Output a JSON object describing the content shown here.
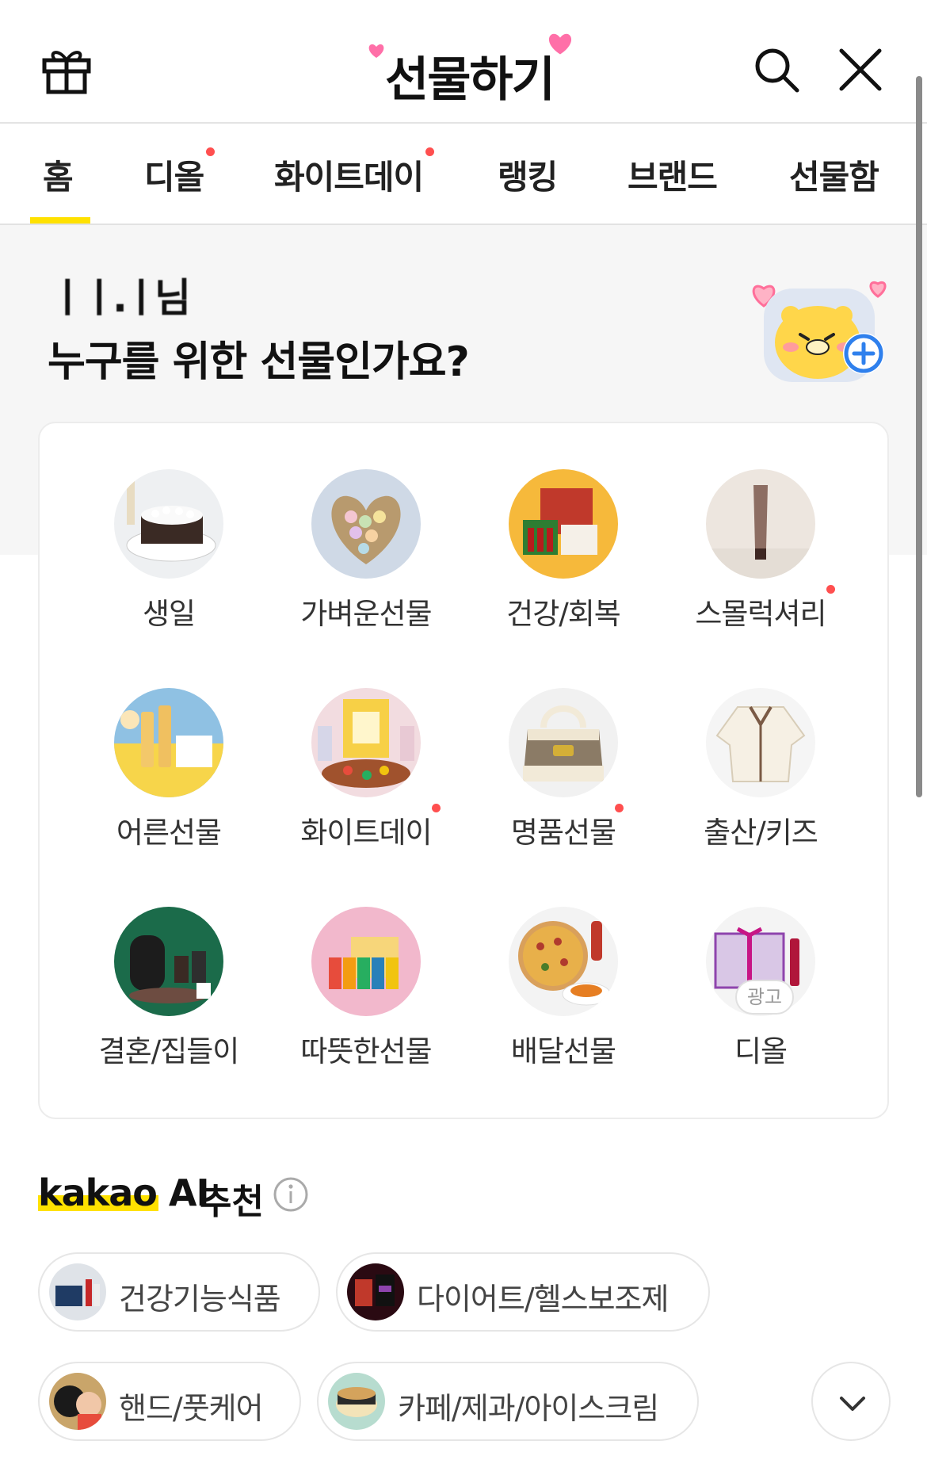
{
  "header": {
    "title": "선물하기",
    "gift_icon": "gift-icon",
    "search_icon": "search-icon",
    "close_icon": "close-icon",
    "accent_color": "#ff6fa8"
  },
  "tabs": [
    {
      "label": "홈",
      "active": true,
      "dot": false
    },
    {
      "label": "디올",
      "active": false,
      "dot": true
    },
    {
      "label": "화이트데이",
      "active": false,
      "dot": true
    },
    {
      "label": "랭킹",
      "active": false,
      "dot": false
    },
    {
      "label": "브랜드",
      "active": false,
      "dot": false
    },
    {
      "label": "선물함",
      "active": false,
      "dot": false
    }
  ],
  "hero": {
    "name": "ㅣㅣ.ㅣ님",
    "question": "누구를 위한 선물인가요?",
    "avatar_icon": "friend-add-icon"
  },
  "categories": [
    {
      "label": "생일",
      "dot": false
    },
    {
      "label": "가벼운선물",
      "dot": false
    },
    {
      "label": "건강/회복",
      "dot": false
    },
    {
      "label": "스몰럭셔리",
      "dot": true
    },
    {
      "label": "어른선물",
      "dot": false
    },
    {
      "label": "화이트데이",
      "dot": true
    },
    {
      "label": "명품선물",
      "dot": true
    },
    {
      "label": "출산/키즈",
      "dot": false
    },
    {
      "label": "결혼/집들이",
      "dot": false
    },
    {
      "label": "따뜻한선물",
      "dot": false
    },
    {
      "label": "배달선물",
      "dot": false
    },
    {
      "label": "디올",
      "dot": false
    }
  ],
  "ad_badge": "광고",
  "ai": {
    "brand": "kakao AI",
    "title": "추천",
    "info_icon": "info-icon",
    "chips": [
      "건강기능식품",
      "다이어트/헬스보조제",
      "핸드/풋케어",
      "카페/제과/아이스크림"
    ],
    "expand_icon": "chevron-down-icon"
  },
  "colors": {
    "highlight": "#ffe100",
    "badge_dot": "#ff4f4f",
    "plus_badge": "#2f80ed"
  }
}
